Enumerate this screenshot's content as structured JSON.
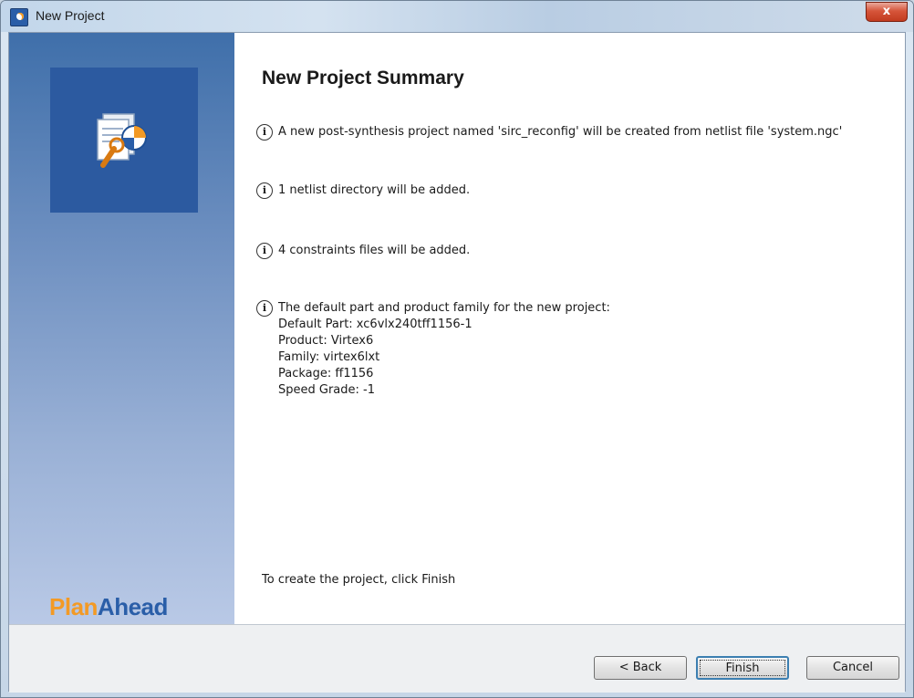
{
  "window": {
    "title": "New Project",
    "close_label": "x"
  },
  "sidebar": {
    "brand_part1": "Plan",
    "brand_part2": "Ahead"
  },
  "main": {
    "heading": "New Project Summary",
    "items": [
      {
        "text": "A new post-synthesis project named 'sirc_reconfig' will be created from netlist file 'system.ngc'"
      },
      {
        "text": "1 netlist directory will be added."
      },
      {
        "text": "4 constraints files will be added."
      },
      {
        "text": "The default part and product family for the new project:",
        "details": [
          "Default Part: xc6vlx240tff1156-1",
          "Product: Virtex6",
          "Family: virtex6lxt",
          "Package: ff1156",
          "Speed Grade: -1"
        ]
      }
    ],
    "footer_text": "To create the project, click Finish"
  },
  "buttons": {
    "back": "< Back",
    "finish": "Finish",
    "cancel": "Cancel"
  }
}
